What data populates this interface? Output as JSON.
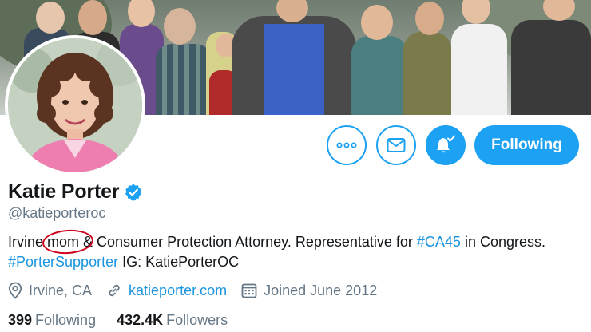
{
  "profile": {
    "name": "Katie Porter",
    "handle": "@katieporteroc",
    "verified": true,
    "bio": {
      "p1": "Irvine ",
      "highlight": "mom",
      "p2": " & Consumer Protection Attorney. Representative for ",
      "tag1": "#CA45",
      "p3": " in Congress. ",
      "tag2": "#PorterSupporter",
      "p4": " IG: KatiePorterOC"
    },
    "location": "Irvine, CA",
    "website": "katieporter.com",
    "joined": "Joined June 2012"
  },
  "stats": {
    "following_count": "399",
    "following_label": "Following",
    "followers_count": "432.4K",
    "followers_label": "Followers"
  },
  "actions": {
    "following_label": "Following"
  },
  "colors": {
    "accent": "#1da1f2",
    "link": "#1b95e0",
    "secondary_text": "#657786",
    "annotation": "#d0021b"
  },
  "icons": [
    "more-icon",
    "mail-icon",
    "bell-icon",
    "verified-badge-icon",
    "location-icon",
    "link-icon",
    "calendar-icon"
  ]
}
